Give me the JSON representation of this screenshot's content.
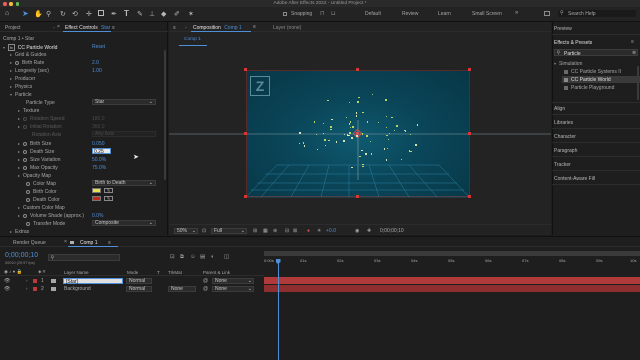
{
  "title_bar": {
    "title": "Adobe After Effects 2022 - Untitled Project *"
  },
  "toolbar": {
    "snapping": "Snapping",
    "workspaces": [
      "Default",
      "Review",
      "Learn",
      "Small Screen"
    ],
    "more": "»",
    "search_placeholder": "Search Help"
  },
  "project_panel": {
    "tab_project": "Project",
    "tab_effect_controls": "Effect Controls",
    "effect_layer": "Star",
    "layer_path": "Comp 1 • Star"
  },
  "effect_controls": {
    "effect_name": "CC Particle World",
    "reset": "Reset",
    "rows": [
      {
        "label": "Grid & Guides",
        "value": ""
      },
      {
        "label": "Birth Rate",
        "value": "2.0"
      },
      {
        "label": "Longevity (sec)",
        "value": "1.00"
      },
      {
        "label": "Producer",
        "value": ""
      },
      {
        "label": "Physics",
        "value": ""
      },
      {
        "label": "Particle",
        "value": ""
      },
      {
        "label": "Particle Type",
        "value": "Star"
      },
      {
        "label": "Texture",
        "value": ""
      },
      {
        "label": "Rotation Speed",
        "value": "180.0"
      },
      {
        "label": "Initial Rotation",
        "value": "360.0"
      },
      {
        "label": "Rotation Axis",
        "value": "Any Axis"
      },
      {
        "label": "Birth Size",
        "value": "0.050"
      },
      {
        "label": "Death Size",
        "value": "0.25"
      },
      {
        "label": "Size Variation",
        "value": "50.0%"
      },
      {
        "label": "Max Opacity",
        "value": "75.0%"
      },
      {
        "label": "Opacity Map",
        "value": ""
      },
      {
        "label": "Color Map",
        "value": "Birth to Death"
      },
      {
        "label": "Birth Color",
        "value": ""
      },
      {
        "label": "Death Color",
        "value": ""
      },
      {
        "label": "Custom Color Map",
        "value": ""
      },
      {
        "label": "Volume Shade (approx.)",
        "value": "0.0%"
      },
      {
        "label": "Transfer Mode",
        "value": "Composite"
      },
      {
        "label": "Extras",
        "value": ""
      }
    ],
    "colors": {
      "birth": "#e8e050",
      "death": "#c02a1a"
    }
  },
  "composition_panel": {
    "tab": "Composition",
    "comp_name": "Comp 1",
    "layer_tab": "Layer (none)",
    "breadcrumb": "Comp 1",
    "zoom": "50%",
    "resolution": "Full",
    "exposure": "+0.0",
    "timecode": "0;00;00;10"
  },
  "right_panel": {
    "preview": "Preview",
    "effects_presets": "Effects & Presets",
    "search_value": "Particle",
    "category": "Simulation",
    "results": [
      "CC Particle Systems II",
      "CC Particle World",
      "Particle Playground"
    ],
    "sections": [
      "Align",
      "Libraries",
      "Character",
      "Paragraph",
      "Tracker",
      "Content-Aware Fill"
    ]
  },
  "timeline": {
    "tab_render_queue": "Render Queue",
    "tab_comp": "Comp 1",
    "timecode": "0;00;00;10",
    "fps": "00010 (29.97 fps)",
    "columns": {
      "source": "Layer Name",
      "mode": "Mode",
      "t": "T",
      "trkmat": "TrkMat",
      "parent": "Parent & Link"
    },
    "layers": [
      {
        "num": "1",
        "name": "[Star]",
        "mode": "Normal",
        "trkmat": "",
        "parent": "None",
        "color": "#c0393a"
      },
      {
        "num": "2",
        "name": "Background",
        "mode": "Normal",
        "trkmat": "None",
        "parent": "None",
        "color": "#c0393a"
      }
    ],
    "ruler": [
      "0:00s",
      "01s",
      "02s",
      "03s",
      "04s",
      "05s",
      "06s",
      "07s",
      "08s",
      "09s",
      "10s"
    ]
  }
}
